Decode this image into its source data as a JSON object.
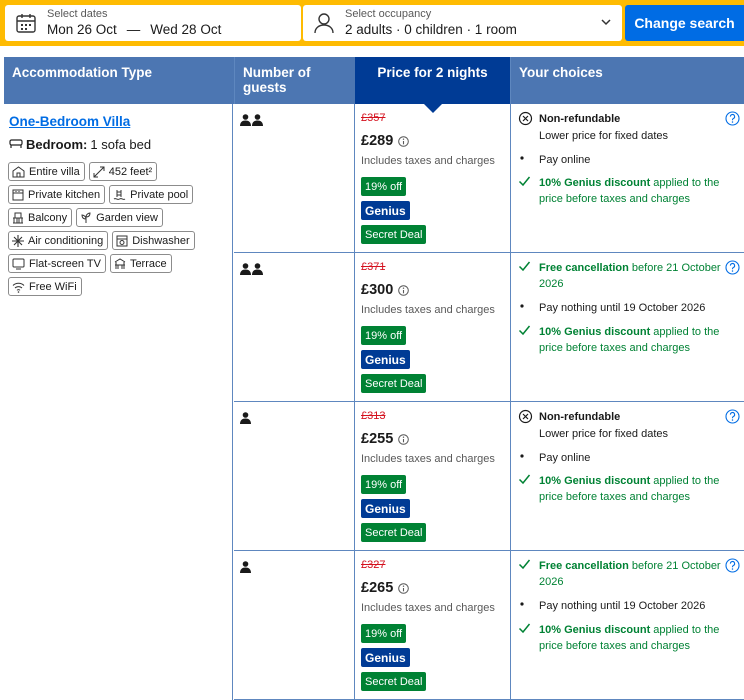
{
  "search": {
    "dates_label": "Select dates",
    "checkin": "Mon 26 Oct",
    "dash": "—",
    "checkout": "Wed 28 Oct",
    "occupancy_label": "Select occupancy",
    "occupancy_value": "2 adults · 0 children · 1 room",
    "change_button": "Change search"
  },
  "table": {
    "headers": {
      "accommodation": "Accommodation Type",
      "guests": "Number of guests",
      "price": "Price for 2 nights",
      "choices": "Your choices"
    }
  },
  "room": {
    "name": "One-Bedroom Villa",
    "bedroom_label": "Bedroom:",
    "bed": "1 sofa bed",
    "facilities": [
      {
        "icon": "villa-icon",
        "label": "Entire villa"
      },
      {
        "icon": "size-icon",
        "label": "452 feet²"
      },
      {
        "icon": "kitchen-icon",
        "label": "Private kitchen"
      },
      {
        "icon": "pool-icon",
        "label": "Private pool"
      },
      {
        "icon": "balcony-icon",
        "label": "Balcony"
      },
      {
        "icon": "garden-icon",
        "label": "Garden view"
      },
      {
        "icon": "snowflake-icon",
        "label": "Air conditioning"
      },
      {
        "icon": "dishwasher-icon",
        "label": "Dishwasher"
      },
      {
        "icon": "tv-icon",
        "label": "Flat-screen TV"
      },
      {
        "icon": "terrace-icon",
        "label": "Terrace"
      },
      {
        "icon": "wifi-icon",
        "label": "Free WiFi"
      }
    ]
  },
  "rows": [
    {
      "guests": 2,
      "old_price": "£357",
      "price": "£289",
      "taxes": "Includes taxes and charges",
      "discount": "19% off",
      "genius": "Genius",
      "secret": "Secret Deal",
      "cancel_bold": "Non-refundable",
      "cancel_rest": "",
      "cancel_sub": "Lower price for fixed dates",
      "pay": "Pay online",
      "genius_bold": "10% Genius discount",
      "genius_rest": " applied to the price before taxes and charges",
      "refundable": false
    },
    {
      "guests": 2,
      "old_price": "£371",
      "price": "£300",
      "taxes": "Includes taxes and charges",
      "discount": "19% off",
      "genius": "Genius",
      "secret": "Secret Deal",
      "cancel_bold": "Free cancellation",
      "cancel_rest": " before 21 October 2026",
      "cancel_sub": "",
      "pay": "Pay nothing until 19 October 2026",
      "genius_bold": "10% Genius discount",
      "genius_rest": " applied to the price before taxes and charges",
      "refundable": true
    },
    {
      "guests": 1,
      "old_price": "£313",
      "price": "£255",
      "taxes": "Includes taxes and charges",
      "discount": "19% off",
      "genius": "Genius",
      "secret": "Secret Deal",
      "cancel_bold": "Non-refundable",
      "cancel_rest": "",
      "cancel_sub": "Lower price for fixed dates",
      "pay": "Pay online",
      "genius_bold": "10% Genius discount",
      "genius_rest": " applied to the price before taxes and charges",
      "refundable": false
    },
    {
      "guests": 1,
      "old_price": "£327",
      "price": "£265",
      "taxes": "Includes taxes and charges",
      "discount": "19% off",
      "genius": "Genius",
      "secret": "Secret Deal",
      "cancel_bold": "Free cancellation",
      "cancel_rest": " before 21 October 2026",
      "cancel_sub": "",
      "pay": "Pay nothing until 19 October 2026",
      "genius_bold": "10% Genius discount",
      "genius_rest": " applied to the price before taxes and charges",
      "refundable": true
    }
  ],
  "colors": {
    "search_bg": "#febb02",
    "primary": "#006ce4",
    "header_bg": "#4c76b2",
    "price_header_bg": "#003b95",
    "green": "#008234",
    "strike_red": "#d4111e"
  }
}
